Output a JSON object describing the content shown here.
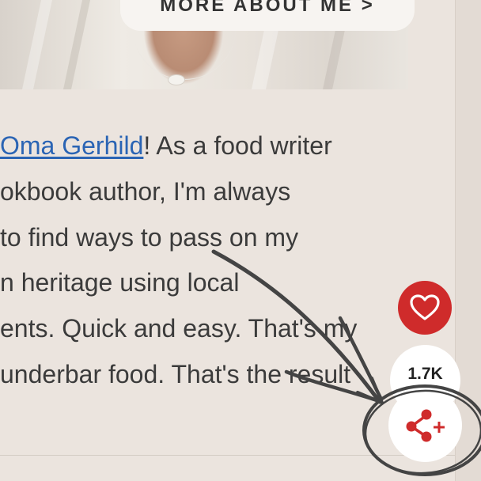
{
  "header": {
    "more_about_me_label": "MORE ABOUT ME >"
  },
  "intro": {
    "link_text": "Oma Gerhild",
    "lines": [
      "! As a food writer",
      "okbook author, I'm always",
      "to find ways to pass on my",
      "n heritage using local",
      "ents. Quick and easy. That's my",
      "underbar food. That's the result"
    ]
  },
  "social": {
    "share_count": "1.7K",
    "heart_icon": "heart-icon",
    "share_icon": "share-plus-icon"
  },
  "colors": {
    "page_bg": "#ebe4de",
    "link": "#2a64b4",
    "heart_button": "#cf2b2b",
    "share_icon": "#cf2b2b",
    "annotation": "#444444"
  }
}
